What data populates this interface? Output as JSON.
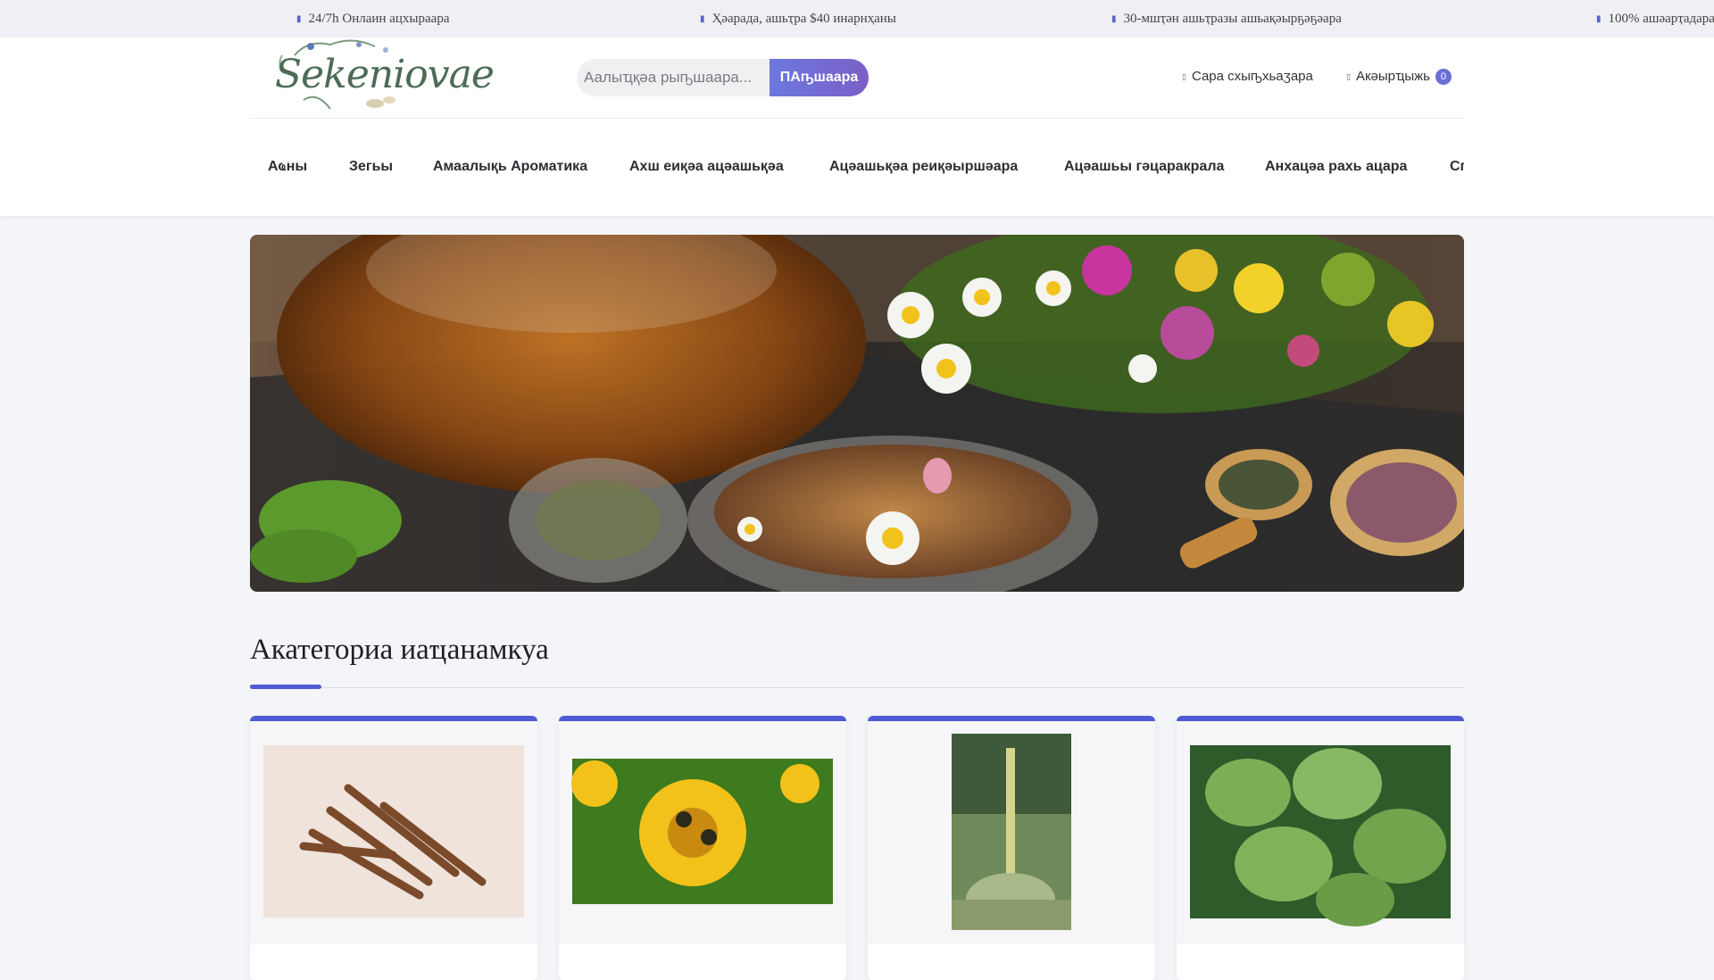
{
  "topbar": {
    "items": [
      {
        "text": "24/7h Онлаин ацхыраара",
        "icon": "headset-icon"
      },
      {
        "text": "Ҳәарада, ашьҭра $40 инарнҳаны",
        "icon": "truck-icon"
      },
      {
        "text": "30-мшҭән ашьҭразы ашьақәырҕәҕәара",
        "icon": "return-icon"
      },
      {
        "text": "100% ашәарҭадара",
        "icon": "shield-icon"
      }
    ]
  },
  "header": {
    "logo_text": "Sekeniovae",
    "search": {
      "placeholder": "Аалыҵқәа рыҧшаара...",
      "button": "ПАҧшаара"
    },
    "account_label": "Сара схыҧхьаӡара",
    "cart_label": "Акәырҵыжь",
    "cart_count": "0"
  },
  "nav": {
    "items": [
      "Аҩны",
      "Зегьы",
      "Амаалықь Ароматика",
      "Ахш еиқәа ацәашьқәа",
      "Ацәашьқәа реиқәыршәара",
      "Ацәашьы гәцаракрала",
      "Анхацәа рахь ацара",
      "Сп"
    ]
  },
  "section": {
    "title": "Акатегориа иаҵанамкуа"
  },
  "cards": [
    {
      "image": "licorice-root-photo"
    },
    {
      "image": "elecampane-flower-photo"
    },
    {
      "image": "mullein-plant-photo"
    },
    {
      "image": "lemon-balm-leaves-photo"
    }
  ],
  "colors": {
    "accent": "#4f5bd5",
    "button": "#6b78de",
    "badge": "#6a6fd6"
  }
}
